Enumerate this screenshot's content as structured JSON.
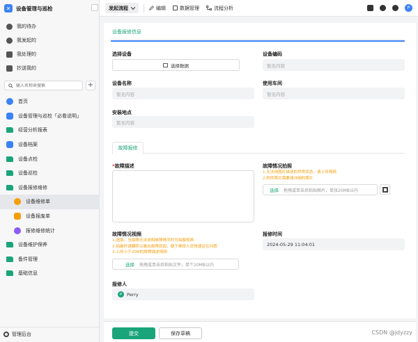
{
  "app": {
    "title": "设备管理与巡检"
  },
  "quick_nav": [
    {
      "label": "我的待办",
      "icon": "todo-icon"
    },
    {
      "label": "我发起的",
      "icon": "send-icon"
    },
    {
      "label": "我处理的",
      "icon": "handled-icon"
    },
    {
      "label": "抄送我的",
      "icon": "cc-icon"
    }
  ],
  "search": {
    "placeholder": "输入名称来搜索"
  },
  "nav": [
    {
      "label": "首页",
      "icon": "home-icon",
      "level": 0
    },
    {
      "label": "设备管理与巡检「必看说明」",
      "icon": "doc-icon",
      "level": 0
    },
    {
      "label": "经营分析报表",
      "icon": "folder-icon",
      "level": 0
    },
    {
      "label": "设备档案",
      "icon": "doc-icon",
      "level": 0
    },
    {
      "label": "设备点检",
      "icon": "folder-icon",
      "level": 0
    },
    {
      "label": "设备巡检",
      "icon": "folder-icon",
      "level": 0
    },
    {
      "label": "设备报修维修",
      "icon": "folder-icon",
      "level": 0
    },
    {
      "label": "设备维修单",
      "icon": "user-icon",
      "level": 1,
      "active": true
    },
    {
      "label": "设备报废单",
      "icon": "form-icon",
      "level": 1
    },
    {
      "label": "报修维修统计",
      "icon": "stats-icon",
      "level": 1
    },
    {
      "label": "设备维护保养",
      "icon": "folder-icon",
      "level": 0
    },
    {
      "label": "备件管理",
      "icon": "folder-icon",
      "level": 0
    },
    {
      "label": "基础信息",
      "icon": "folder-icon",
      "level": 0
    }
  ],
  "admin": {
    "label": "管理后台"
  },
  "topbar": {
    "flow_label": "发起流程",
    "edit_label": "编辑",
    "data_label": "数据管理",
    "analysis_label": "流程分析",
    "avatar_letter": "P"
  },
  "form": {
    "section_title": "设备报修信息",
    "select_device_label": "选择设备",
    "select_data_button": "选择数据",
    "device_code_label": "设备编码",
    "device_code_value": "暂无内容",
    "device_name_label": "设备名称",
    "device_name_value": "暂无内容",
    "workshop_label": "使用车间",
    "workshop_value": "暂无内容",
    "location_label": "安装地点",
    "location_value": "暂无内容",
    "fault_tab": "故障报修",
    "fault_desc_label": "故障描述",
    "fault_desc_required": "*",
    "fault_photo_label": "故障情况拍照",
    "fault_photo_hints": [
      "1.无法用图片描述的异常状态，请上传视频",
      "2.附件照片需要请详细的照片"
    ],
    "photo_upload_pick": "选择",
    "photo_upload_hint": "拖拽或单击后粘贴图片，单张20MB以内",
    "fault_video_label": "故障情况视频",
    "fault_video_hints": [
      "1.选填，当拍照无法说明故障情况时可拍摄视频",
      "2.拍摄时请翻转以露出故障原因，便于维修人员快速定位问题",
      "3.上传小于20M的故障描述视频"
    ],
    "video_upload_pick": "选择",
    "video_upload_hint": "拖拽或单击后粘贴文件，单个20MB以内",
    "report_time_label": "报修时间",
    "report_time_value": "2024-05-29 11:04:01",
    "reporter_label": "报修人",
    "reporter_initial": "P",
    "reporter_name": "Perry"
  },
  "bottom": {
    "submit_label": "提交",
    "draft_label": "保存草稿"
  },
  "watermark": "CSDN @jdyzzy",
  "colors": {
    "accent_green": "#1aa47a",
    "accent_blue": "#3b82f6",
    "hint_orange": "#f59e0b"
  }
}
